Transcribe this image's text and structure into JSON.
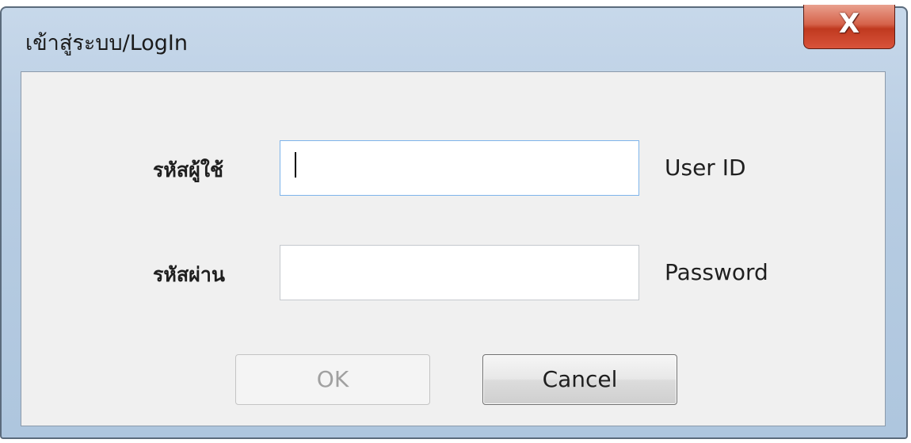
{
  "window": {
    "title": "เข้าสู่ระบบ/LogIn",
    "close_glyph": "X"
  },
  "form": {
    "user_id": {
      "label_th": "รหัสผู้ใช้",
      "label_en": "User ID",
      "value": ""
    },
    "password": {
      "label_th": "รหัสผ่าน",
      "label_en": "Password",
      "value": ""
    }
  },
  "buttons": {
    "ok_label": "OK",
    "cancel_label": "Cancel"
  },
  "colors": {
    "titlebar": "#b7cce2",
    "close_button": "#c0391f",
    "client_background": "#f0f0f0",
    "focus_border": "#7eb4ea"
  }
}
